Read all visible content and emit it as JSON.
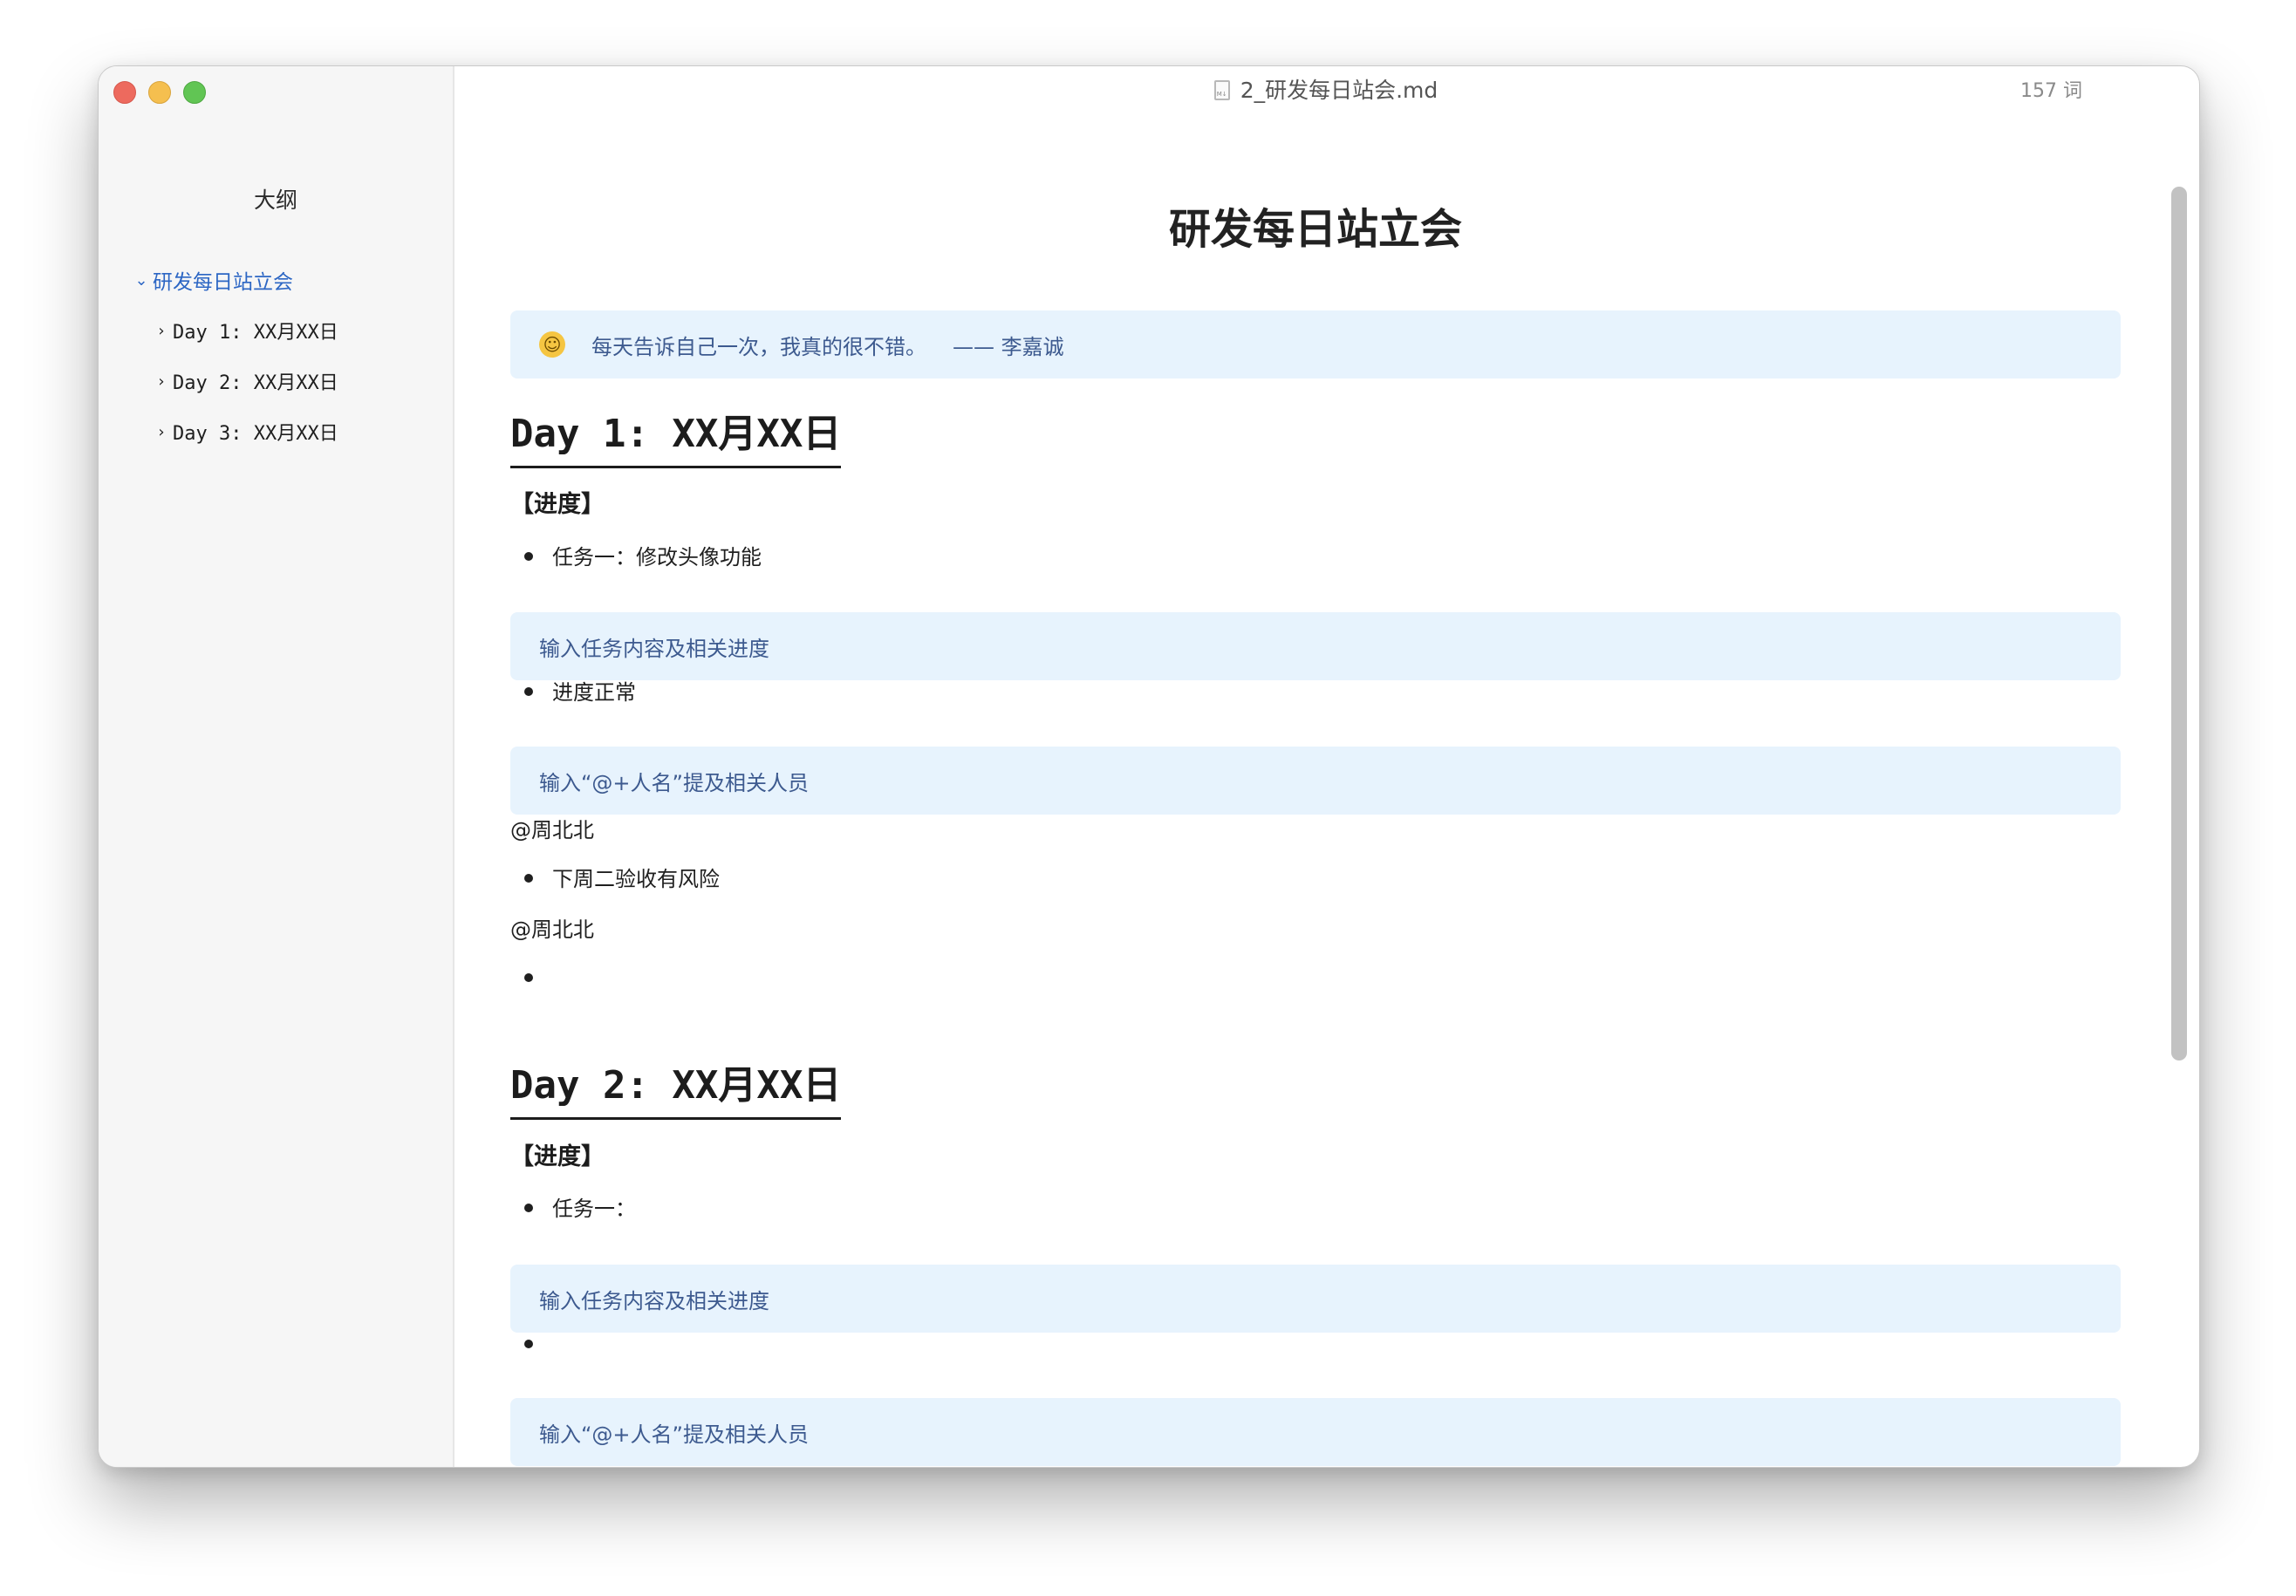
{
  "window": {
    "file_name": "2_研发每日站会.md",
    "word_count": "157 词"
  },
  "sidebar": {
    "title": "大纲",
    "items": [
      {
        "label": "研发每日站立会",
        "chevron": "⌄"
      },
      {
        "label": "Day 1: XX月XX日",
        "chevron": "›"
      },
      {
        "label": "Day 2: XX月XX日",
        "chevron": "›"
      },
      {
        "label": "Day 3: XX月XX日",
        "chevron": "›"
      }
    ]
  },
  "doc": {
    "title": "研发每日站立会",
    "quote": {
      "emoji": "☺",
      "text": "每天告诉自己一次，我真的很不错。",
      "author": "—— 李嘉诚"
    },
    "day1": {
      "heading": "Day 1: XX月XX日",
      "progress_label": "【进度】",
      "task": "任务一：修改头像功能",
      "task_hint": "输入任务内容及相关进度",
      "status": "进度正常",
      "mention_hint": "输入“@+人名”提及相关人员",
      "mention1": "@周北北",
      "risk": "下周二验收有风险",
      "mention2": "@周北北",
      "empty_bullet": ""
    },
    "day2": {
      "heading": "Day 2: XX月XX日",
      "progress_label": "【进度】",
      "task": "任务一：",
      "task_hint": "输入任务内容及相关进度",
      "empty_bullet1": "",
      "mention_hint": "输入“@+人名”提及相关人员",
      "empty_bullet2": ""
    }
  },
  "colors": {
    "accent": "#2c66c4",
    "callout_bg": "#e7f3fd",
    "callout_text": "#3d5a8f"
  }
}
